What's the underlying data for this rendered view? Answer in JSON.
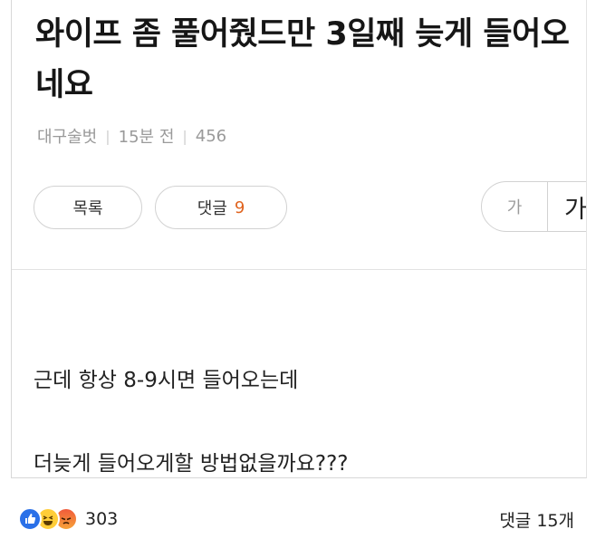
{
  "post": {
    "title": "와이프 좀 풀어줬드만 3일째 늦게 들어오네요",
    "author": "대구술벗",
    "time": "15분 전",
    "views": "456"
  },
  "toolbar": {
    "list_label": "목록",
    "comments_label": "댓글",
    "comments_count": "9",
    "font_small_label": "가",
    "font_large_label": "가"
  },
  "body": {
    "line1": "근데 항상 8-9시면 들어오는데",
    "line2": "더늦게 들어오게할 방법없을까요???"
  },
  "footer": {
    "reaction_icons": [
      "like-icon",
      "haha-icon",
      "angry-icon"
    ],
    "reaction_count": "303",
    "comment_count": "댓글 15개"
  },
  "colors": {
    "accent": "#e0631e",
    "like": "#2a70e8"
  }
}
